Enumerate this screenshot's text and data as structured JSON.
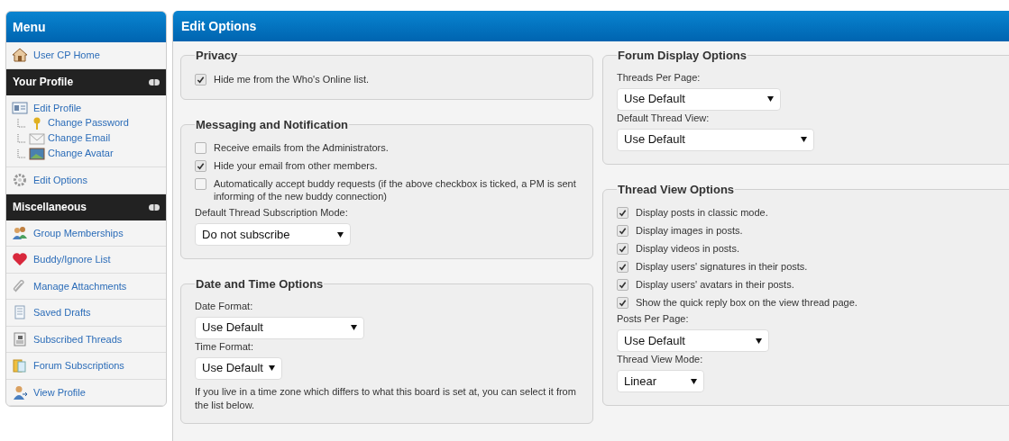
{
  "sidebar": {
    "title": "Menu",
    "items": [
      {
        "kind": "link",
        "label": "User CP Home"
      },
      {
        "kind": "header",
        "label": "Your Profile"
      },
      {
        "kind": "link",
        "label": "Edit Profile",
        "children": [
          {
            "label": "Change Password"
          },
          {
            "label": "Change Email"
          },
          {
            "label": "Change Avatar"
          }
        ]
      },
      {
        "kind": "link",
        "label": "Edit Options"
      },
      {
        "kind": "header",
        "label": "Miscellaneous"
      },
      {
        "kind": "link",
        "label": "Group Memberships"
      },
      {
        "kind": "link",
        "label": "Buddy/Ignore List"
      },
      {
        "kind": "link",
        "label": "Manage Attachments"
      },
      {
        "kind": "link",
        "label": "Saved Drafts"
      },
      {
        "kind": "link",
        "label": "Subscribed Threads"
      },
      {
        "kind": "link",
        "label": "Forum Subscriptions"
      },
      {
        "kind": "link",
        "label": "View Profile"
      }
    ]
  },
  "main": {
    "title": "Edit Options",
    "columns": [
      [
        {
          "legend": "Privacy",
          "fields": [
            {
              "kind": "checkbox",
              "label": "Hide me from the Who's Online list.",
              "checked": true
            }
          ]
        },
        {
          "legend": "Messaging and Notification",
          "fields": [
            {
              "kind": "checkbox",
              "label": "Receive emails from the Administrators.",
              "checked": false
            },
            {
              "kind": "checkbox",
              "label": "Hide your email from other members.",
              "checked": true
            },
            {
              "kind": "checkbox",
              "label": "Automatically accept buddy requests (if the above checkbox is ticked, a PM is sent informing of the new buddy connection)",
              "checked": false
            },
            {
              "kind": "select",
              "label": "Default Thread Subscription Mode:",
              "value": "Do not subscribe"
            }
          ]
        },
        {
          "legend": "Date and Time Options",
          "fields": [
            {
              "kind": "select",
              "label": "Date Format:",
              "value": "Use Default"
            },
            {
              "kind": "select",
              "label": "Time Format:",
              "value": "Use Default"
            },
            {
              "kind": "text",
              "label": "If you live in a time zone which differs to what this board is set at, you can select it from the list below."
            }
          ]
        }
      ],
      [
        {
          "legend": "Forum Display Options",
          "fields": [
            {
              "kind": "select",
              "label": "Threads Per Page:",
              "value": "Use Default"
            },
            {
              "kind": "select",
              "label": "Default Thread View:",
              "value": "Use Default"
            }
          ]
        },
        {
          "legend": "Thread View Options",
          "fields": [
            {
              "kind": "checkbox",
              "label": "Display posts in classic mode.",
              "checked": true
            },
            {
              "kind": "checkbox",
              "label": "Display images in posts.",
              "checked": true
            },
            {
              "kind": "checkbox",
              "label": "Display videos in posts.",
              "checked": true
            },
            {
              "kind": "checkbox",
              "label": "Display users' signatures in their posts.",
              "checked": true
            },
            {
              "kind": "checkbox",
              "label": "Display users' avatars in their posts.",
              "checked": true
            },
            {
              "kind": "checkbox",
              "label": "Show the quick reply box on the view thread page.",
              "checked": true
            },
            {
              "kind": "select",
              "label": "Posts Per Page:",
              "value": "Use Default"
            },
            {
              "kind": "select",
              "label": "Thread View Mode:",
              "value": "Linear"
            }
          ]
        }
      ]
    ]
  }
}
